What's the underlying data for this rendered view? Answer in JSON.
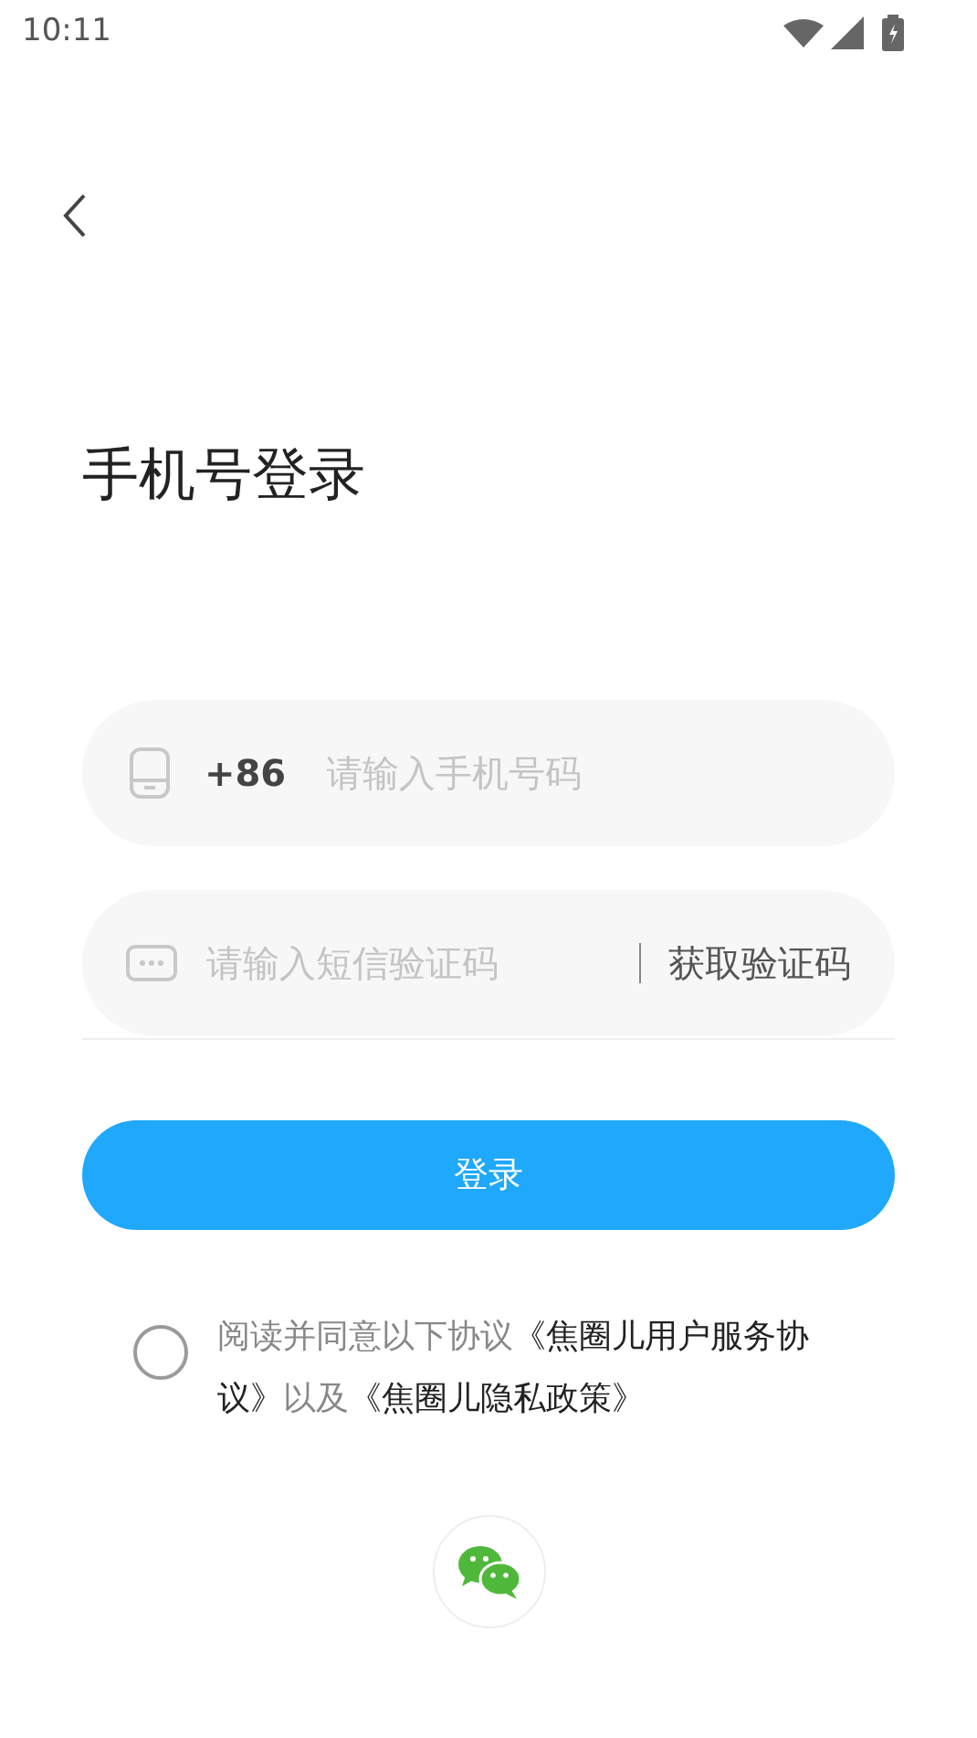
{
  "status_bar": {
    "time": "10:11"
  },
  "title": "手机号登录",
  "phone_field": {
    "prefix": "+86",
    "placeholder": "请输入手机号码"
  },
  "code_field": {
    "placeholder": "请输入短信验证码",
    "action": "获取验证码"
  },
  "login_button": "登录",
  "agreement": {
    "checked": false,
    "parts": [
      {
        "kind": "plain",
        "text": "阅读并同意以下协议"
      },
      {
        "kind": "link",
        "text": "《焦圈儿用户服务协议》"
      },
      {
        "kind": "plain",
        "text": "以及"
      },
      {
        "kind": "link",
        "text": "《焦圈儿隐私政策》"
      }
    ]
  }
}
